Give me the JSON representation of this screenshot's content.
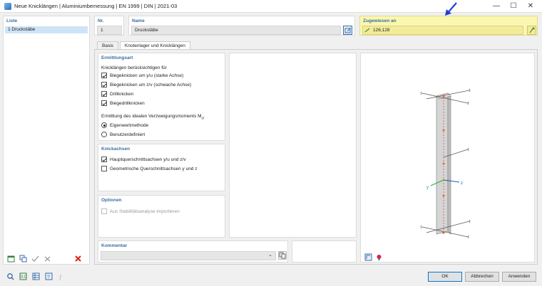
{
  "window": {
    "title": "Neue Knicklängen | Aluminiumbemessung | EN 1999 | DIN | 2021-03",
    "minimize": "—",
    "maximize": "☐",
    "close": "✕"
  },
  "list": {
    "header": "Liste",
    "items": [
      {
        "label": "1  Druckstäbe"
      }
    ]
  },
  "nr": {
    "label": "Nr.",
    "value": "1"
  },
  "name": {
    "label": "Name",
    "value": "Druckstäbe"
  },
  "assigned": {
    "label": "Zugewiesen an",
    "value": "126,128",
    "color": "#fbf7b0"
  },
  "tabs": [
    "Basis",
    "Knotenlager und Knicklängen"
  ],
  "determination": {
    "header": "Ermittlungsart",
    "consider_label": "Knicklängen berücksichtigen für",
    "checks": [
      {
        "label": "Biegeknicken um y/u (starke Achse)",
        "checked": true
      },
      {
        "label": "Biegeknicken um z/v (schwache Achse)",
        "checked": true
      },
      {
        "label": "Drillknicken",
        "checked": true
      },
      {
        "label": "Biegedrillknicken",
        "checked": true
      }
    ],
    "moment_label": "Ermittlung des idealen Verzweigungsmoments M",
    "moment_sub": "cr",
    "radios": [
      {
        "label": "Eigenwertmethode",
        "selected": true
      },
      {
        "label": "Benutzerdefiniert",
        "selected": false
      }
    ]
  },
  "axes": {
    "header": "Knickachsen",
    "checks": [
      {
        "label": "Hauptquerschnittsachsen y/u und z/v",
        "checked": true
      },
      {
        "label": "Geometrische Querschnittsachsen y und z",
        "checked": false
      }
    ]
  },
  "options": {
    "header": "Optionen",
    "checks": [
      {
        "label": "Aus Stabilitätsanalyse importieren",
        "checked": false
      }
    ]
  },
  "comment": {
    "header": "Kommentar",
    "value": ""
  },
  "viewer": {
    "axis_y": "y",
    "axis_z": "z"
  },
  "buttons": {
    "ok": "OK",
    "cancel": "Abbrechen",
    "apply": "Anwenden"
  }
}
